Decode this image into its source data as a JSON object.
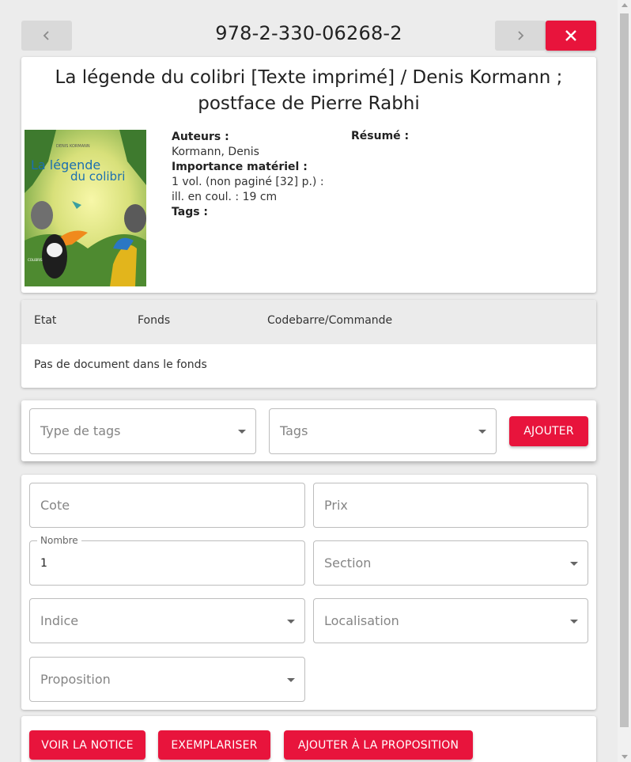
{
  "header": {
    "isbn": "978-2-330-06268-2",
    "prev_icon": "chevron-left-icon",
    "next_icon": "chevron-right-icon",
    "close_icon": "close-icon"
  },
  "book": {
    "title": "La légende du colibri [Texte imprimé] / Denis Kormann ; postface de Pierre Rabhi",
    "cover_title_line1": "La légende",
    "cover_title_line2": "du colibri",
    "cover_author": "DENIS KORMANN",
    "cover_publisher": "COLIBRIS",
    "authors_label": "Auteurs :",
    "authors_value": "Kormann, Denis",
    "material_label": "Importance matériel :",
    "material_value": "1 vol. (non paginé [32] p.) : ill. en coul. : 19 cm",
    "tags_label": "Tags :",
    "resume_label": "Résumé :"
  },
  "fonds": {
    "columns": [
      "Etat",
      "Fonds",
      "Codebarre/Commande"
    ],
    "empty_message": "Pas de document dans le fonds"
  },
  "tags_form": {
    "type_placeholder": "Type de tags",
    "tags_placeholder": "Tags",
    "add_label": "AJOUTER"
  },
  "item_form": {
    "cote_placeholder": "Cote",
    "prix_placeholder": "Prix",
    "nombre_label": "Nombre",
    "nombre_value": "1",
    "section_placeholder": "Section",
    "indice_placeholder": "Indice",
    "localisation_placeholder": "Localisation",
    "proposition_placeholder": "Proposition"
  },
  "actions": {
    "voir_label": "VOIR LA NOTICE",
    "exemplariser_label": "EXEMPLARISER",
    "ajouter_proposition_label": "AJOUTER À LA PROPOSITION"
  },
  "colors": {
    "accent": "#e8143c",
    "background": "#ececec",
    "card": "#ffffff"
  }
}
